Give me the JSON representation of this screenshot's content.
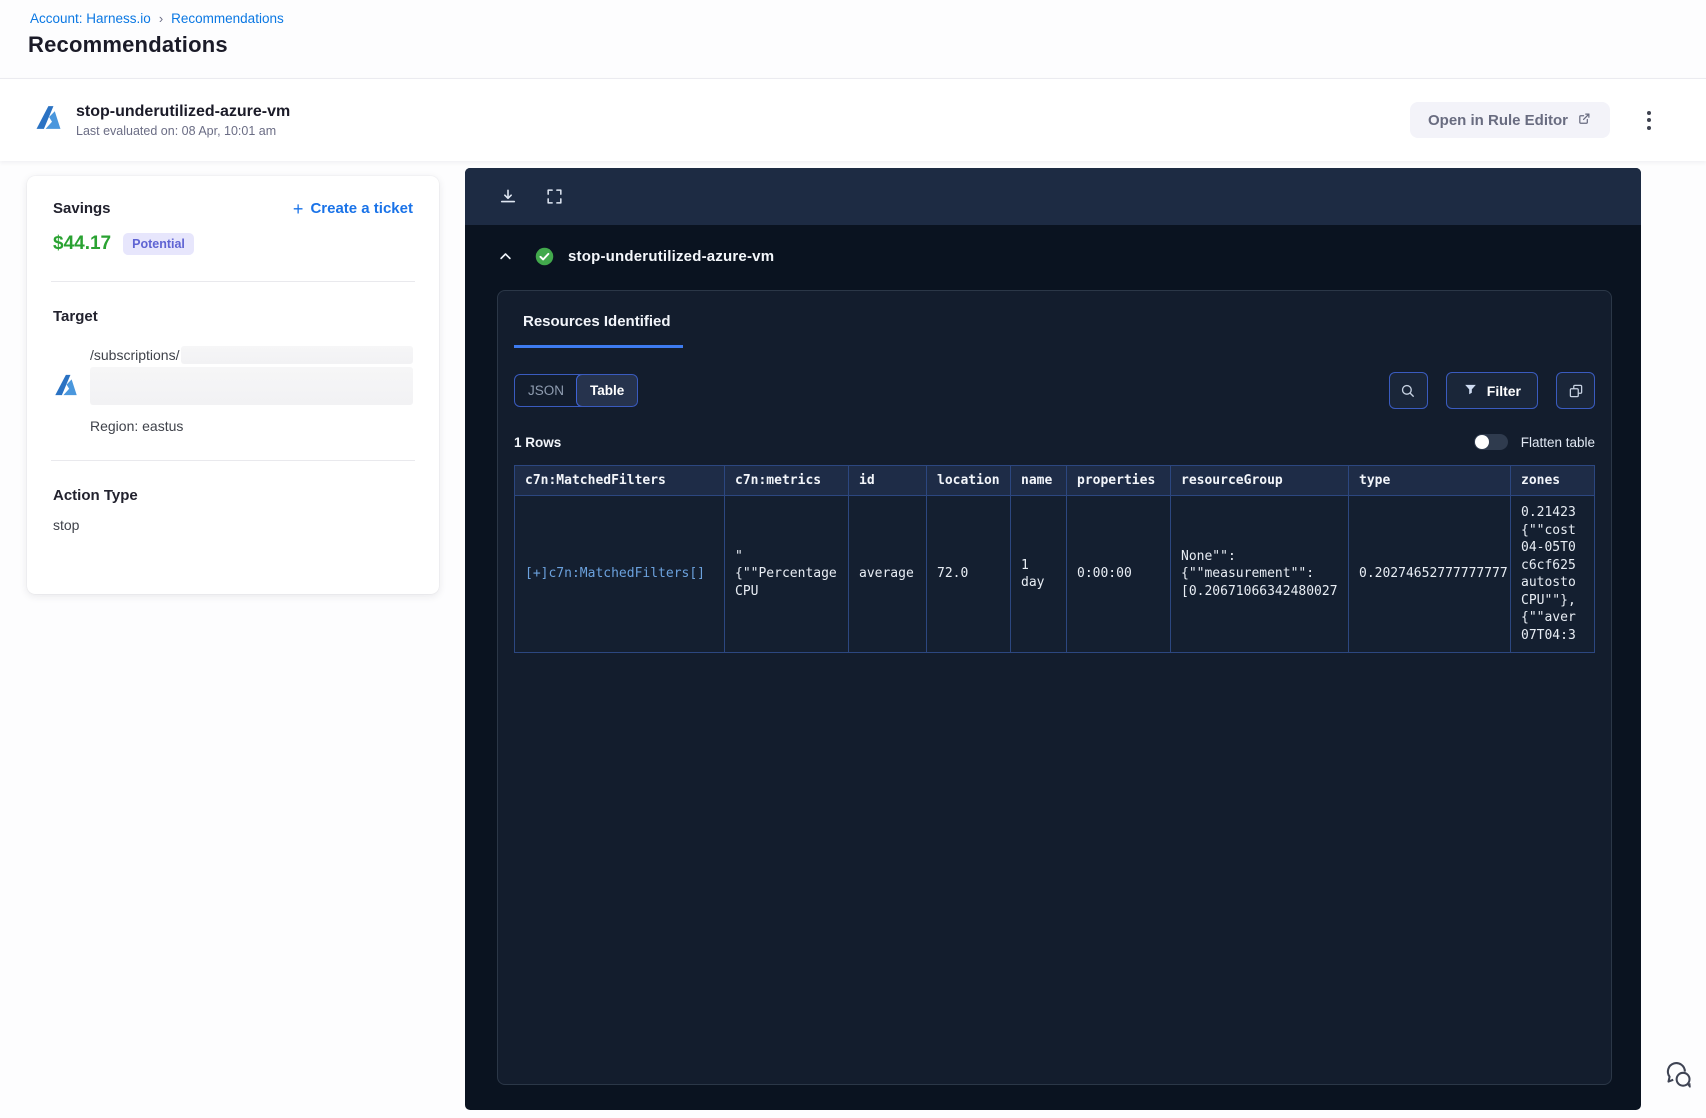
{
  "colors": {
    "accent-blue": "#3d7bf0",
    "link-blue": "#0b78e3",
    "savings-green": "#2aa232",
    "potential-bg": "#e7e6fc",
    "potential-text": "#5f64d3",
    "check-green": "#42a94c",
    "panel-bg": "#0a1320",
    "toolbar-bg": "#1d2b43",
    "card-bg": "#131d2d",
    "table-border": "#2c4780",
    "button-border": "#3a5bbf"
  },
  "breadcrumb": {
    "account_link": "Account: Harness.io",
    "separator": "›",
    "current": "Recommendations"
  },
  "page_title": "Recommendations",
  "header": {
    "rule_name": "stop-underutilized-azure-vm",
    "last_evaluated": "Last evaluated on: 08 Apr, 10:01 am",
    "open_rule_editor": "Open in Rule Editor"
  },
  "details": {
    "savings_label": "Savings",
    "savings_amount": "$44.17",
    "savings_badge": "Potential",
    "create_ticket": "Create a ticket",
    "target_label": "Target",
    "target_path": "/subscriptions/",
    "target_region": "Region: eastus",
    "action_type_label": "Action Type",
    "action_type_value": "stop"
  },
  "panel": {
    "rule_name": "stop-underutilized-azure-vm",
    "tab_label": "Resources Identified",
    "toggle_json": "JSON",
    "toggle_table": "Table",
    "filter_label": "Filter",
    "rows_count": "1 Rows",
    "flatten_label": "Flatten table",
    "table": {
      "columns": [
        "c7n:MatchedFilters",
        "c7n:metrics",
        "id",
        "location",
        "name",
        "properties",
        "resourceGroup",
        "type",
        "zones"
      ],
      "rows": [
        [
          "[+]c7n:MatchedFilters[]",
          "\"\n{\"\"Percentage CPU",
          "average",
          "72.0",
          "1 day",
          "0:00:00",
          "None\"\":\n{\"\"measurement\"\":\n[0.20671066342480027",
          "0.20274652777777777",
          "0.21423\n{\"\"cost\n04-05T0\nc6cf625\nautosto\nCPU\"\"},\n{\"\"aver\n07T04:3"
        ]
      ]
    }
  }
}
